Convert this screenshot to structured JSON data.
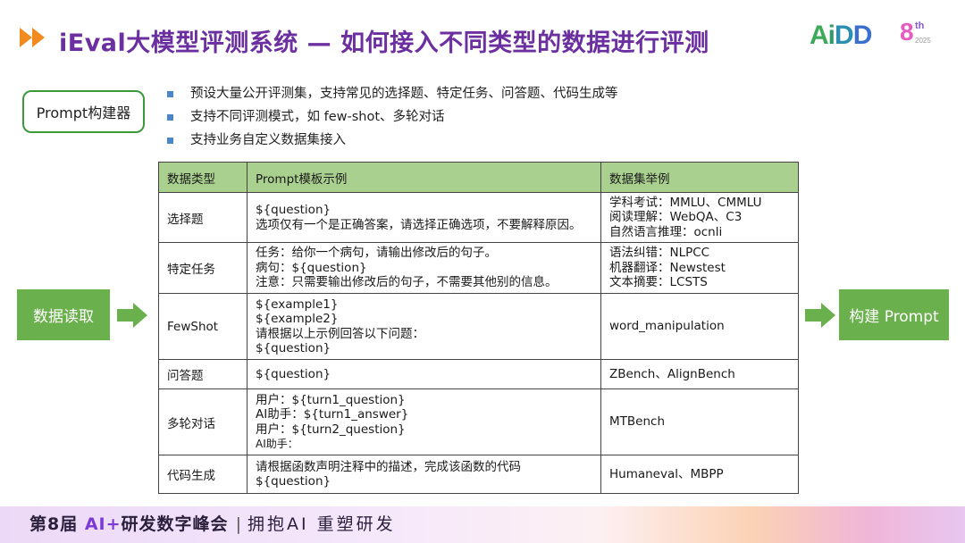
{
  "header": {
    "title": "iEval大模型评测系统 — 如何接入不同类型的数据进行评测",
    "logo": {
      "text": "AiDD",
      "edition": "8",
      "suffix": "th",
      "year": "2025"
    }
  },
  "builder": {
    "label": "Prompt构建器",
    "bullets": [
      "预设大量公开评测集，支持常见的选择题、特定任务、问答题、代码生成等",
      "支持不同评测模式，如 few-shot、多轮对话",
      "支持业务自定义数据集接入"
    ]
  },
  "flow": {
    "left_label": "数据读取",
    "right_label": "构建 Prompt"
  },
  "table": {
    "headers": [
      "数据类型",
      "Prompt模板示例",
      "数据集举例"
    ],
    "rows": [
      {
        "type": "选择题",
        "template": [
          "${question}",
          "选项仅有一个是正确答案，请选择正确选项，不要解释原因。"
        ],
        "datasets": [
          "学科考试：MMLU、CMMLU",
          "阅读理解：WebQA、C3",
          "自然语言推理：ocnli"
        ]
      },
      {
        "type": "特定任务",
        "template": [
          "任务：给你一个病句，请输出修改后的句子。",
          "病句：${question}",
          "注意：只需要输出修改后的句子，不需要其他别的信息。"
        ],
        "datasets": [
          "语法纠错：NLPCC",
          "机器翻译：Newstest",
          "文本摘要：LCSTS"
        ]
      },
      {
        "type": "FewShot",
        "template": [
          "${example1}",
          "${example2}",
          "请根据以上示例回答以下问题：",
          "${question}"
        ],
        "datasets": [
          "word_manipulation"
        ]
      },
      {
        "type": "问答题",
        "template": [
          "${question}"
        ],
        "datasets": [
          "ZBench、AlignBench"
        ]
      },
      {
        "type": "多轮对话",
        "template": [
          "用户：${turn1_question}",
          "AI助手：${turn1_answer}",
          "用户：${turn2_question}",
          "AI助手："
        ],
        "datasets": [
          "MTBench"
        ]
      },
      {
        "type": "代码生成",
        "template": [
          "请根据函数声明注释中的描述，完成该函数的代码",
          "${question}"
        ],
        "datasets": [
          "Humaneval、MBPP"
        ]
      }
    ]
  },
  "footer": {
    "event_prefix": "第8届 ",
    "event_ai": "AI+",
    "event_suffix": "研发数字峰会",
    "separator": "|",
    "slogan": "拥抱AI 重塑研发"
  },
  "colors": {
    "title": "#6b2fa0",
    "accent_orange": "#f28a1e",
    "green": "#6ab04c",
    "header_green": "#a9d08e",
    "bullet_blue": "#4a86c8"
  }
}
